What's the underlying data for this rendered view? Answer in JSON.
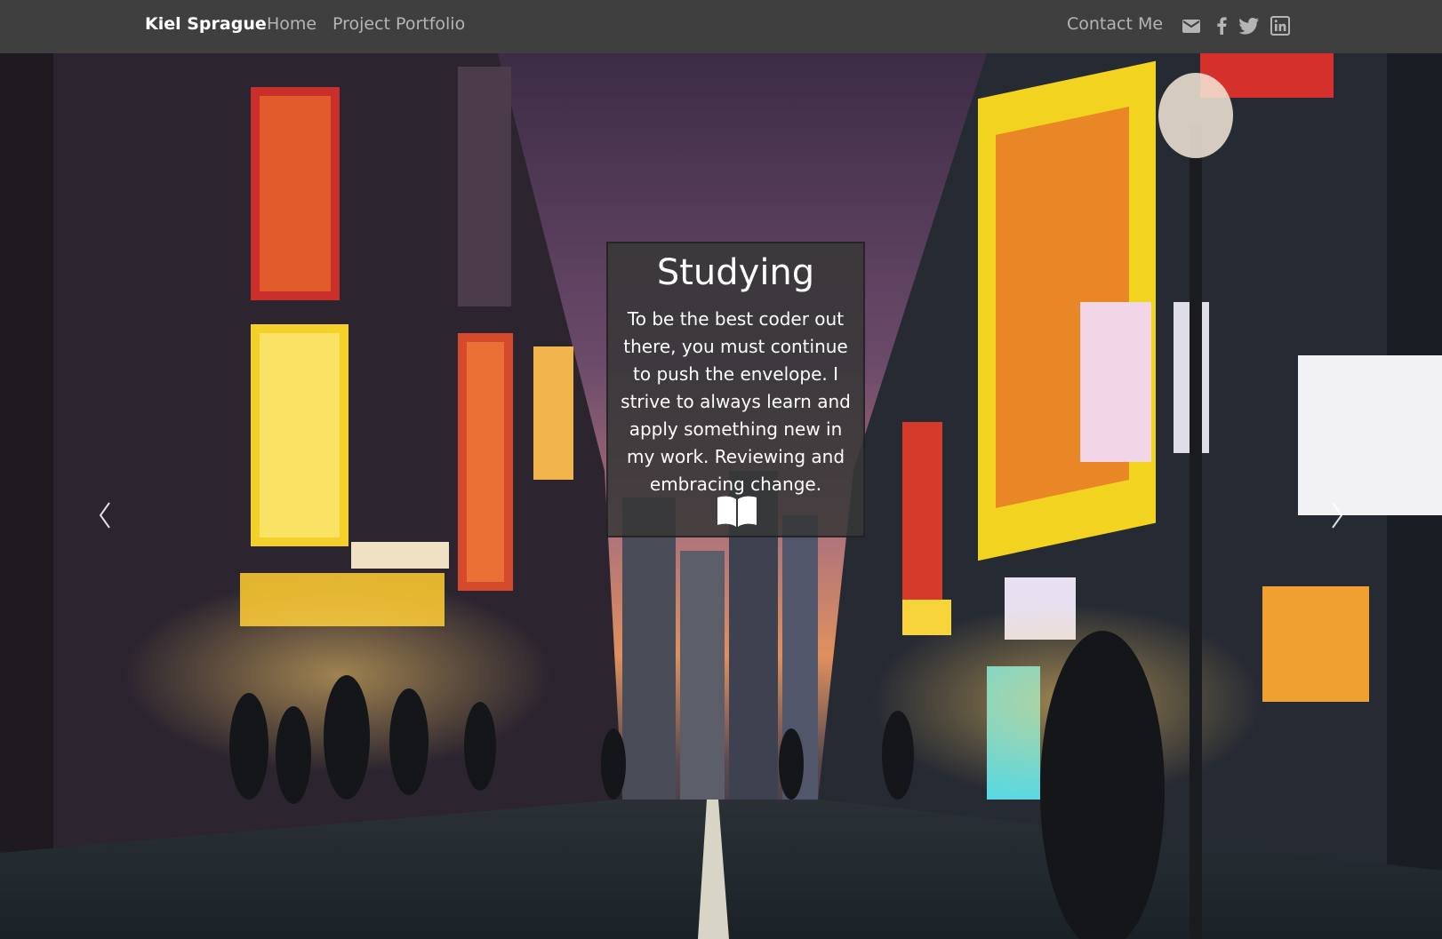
{
  "navbar": {
    "brand": "Kiel Sprague",
    "links": {
      "home": "Home",
      "portfolio": "Project Portfolio",
      "contact": "Contact Me"
    },
    "social_icons": [
      "envelope-icon",
      "facebook-icon",
      "twitter-icon",
      "linkedin-icon"
    ],
    "colors": {
      "background": "#3f3f3f",
      "brand": "#ffffff",
      "link": "#b5b5b5"
    }
  },
  "carousel": {
    "background": "night city street with neon signs",
    "controls": {
      "prev": "chevron-left-icon",
      "next": "chevron-right-icon"
    },
    "slide": {
      "title": "Studying",
      "text": "To be the best coder out there, you must continue to push the envelope. I strive to always learn and apply something new in my work. Reviewing and embracing change.",
      "icon": "book-open-icon"
    }
  }
}
